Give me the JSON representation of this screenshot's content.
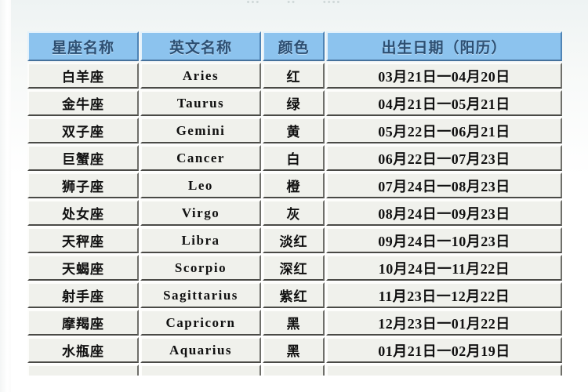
{
  "page": {
    "top_ghost_marks": [
      "•••",
      "••",
      "••••"
    ],
    "accent_header_blue": "#8cc3ee",
    "header_text_color": "#2d4f72",
    "cell_background": "#f0f1ec",
    "page_background": "#ffffff"
  },
  "table": {
    "columns": [
      {
        "key": "name",
        "label": "星座名称"
      },
      {
        "key": "english",
        "label": "英文名称"
      },
      {
        "key": "color",
        "label": "颜色"
      },
      {
        "key": "date",
        "label": "出生日期（阳历）"
      }
    ],
    "rows": [
      {
        "name": "白羊座",
        "english": "Aries",
        "color": "红",
        "date": "03月21日一04月20日"
      },
      {
        "name": "金牛座",
        "english": "Taurus",
        "color": "绿",
        "date": "04月21日一05月21日"
      },
      {
        "name": "双子座",
        "english": "Gemini",
        "color": "黄",
        "date": "05月22日一06月21日"
      },
      {
        "name": "巨蟹座",
        "english": "Cancer",
        "color": "白",
        "date": "06月22日一07月23日"
      },
      {
        "name": "狮子座",
        "english": "Leo",
        "color": "橙",
        "date": "07月24日一08月23日"
      },
      {
        "name": "处女座",
        "english": "Virgo",
        "color": "灰",
        "date": "08月24日一09月23日"
      },
      {
        "name": "天秤座",
        "english": "Libra",
        "color": "淡红",
        "date": "09月24日一10月23日"
      },
      {
        "name": "天蝎座",
        "english": "Scorpio",
        "color": "深红",
        "date": "10月24日一11月22日"
      },
      {
        "name": "射手座",
        "english": "Sagittarius",
        "color": "紫红",
        "date": "11月23日一12月22日"
      },
      {
        "name": "摩羯座",
        "english": "Capricorn",
        "color": "黑",
        "date": "12月23日一01月22日"
      },
      {
        "name": "水瓶座",
        "english": "Aquarius",
        "color": "黑",
        "date": "01月21日一02月19日"
      }
    ]
  }
}
